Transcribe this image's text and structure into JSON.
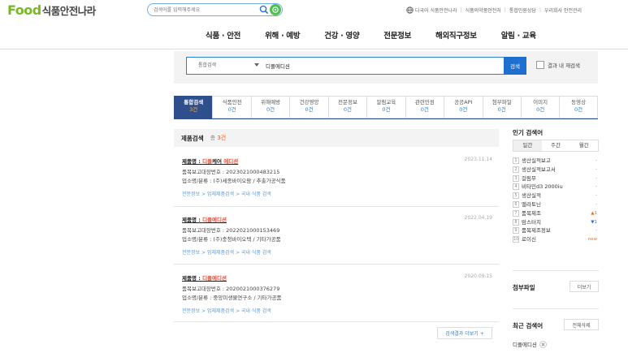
{
  "header": {
    "logo_latin": "Food",
    "logo_korean": "식품안전나라",
    "search_placeholder": "검색어를 입력해주세요",
    "utility": {
      "language": "다국어 식품안전나라",
      "links": [
        "식품의약품안전처",
        "통합민원상담",
        "우리회사 안전관리"
      ]
    }
  },
  "gnb": {
    "items": [
      "식품 · 안전",
      "위해 · 예방",
      "건강 · 영양",
      "전문정보",
      "해외직구정보",
      "알림 · 교육"
    ]
  },
  "search": {
    "scope": "통합검색",
    "query": "디플에디션",
    "button": "검색",
    "in_result_label": "결과 내 재검색"
  },
  "tabs": [
    {
      "label": "통합검색",
      "count": "3건",
      "active": true
    },
    {
      "label": "식품안전",
      "count": "0건"
    },
    {
      "label": "위해예방",
      "count": "0건"
    },
    {
      "label": "건강영양",
      "count": "0건"
    },
    {
      "label": "전문정보",
      "count": "0건"
    },
    {
      "label": "알림교육",
      "count": "0건"
    },
    {
      "label": "관련민원",
      "count": "0건"
    },
    {
      "label": "공공API",
      "count": "0건"
    },
    {
      "label": "첨부파일",
      "count": "0건"
    },
    {
      "label": "이미지",
      "count": "0건"
    },
    {
      "label": "동영상",
      "count": "0건"
    }
  ],
  "results": {
    "title": "제품검색",
    "count_prefix": "총",
    "count": "3건",
    "items": [
      {
        "name_prefix": "제품명 : ",
        "name_highlight": "디플",
        "name_mid": "케어 ",
        "name_highlight2": "에디션",
        "date": "2023.11.14",
        "report_no": "품목보고대장번호 : 2023021000483215",
        "company": "업소명/분류 : (주)세종바이오팜 / 추출가공식품",
        "path": "전문정보 > 업체제품검색 > 국내 식품 검색"
      },
      {
        "name_prefix": "제품명 : ",
        "name_highlight": "디플에디션",
        "name_mid": "",
        "name_highlight2": "",
        "date": "2022.04.19",
        "report_no": "품목보고대장번호 : 2022021000153469",
        "company": "업소명/분류 : (주)충청바이오텍 / 기타가공품",
        "path": "전문정보 > 업체제품검색 > 국내 식품 검색"
      },
      {
        "name_prefix": "제품명 : ",
        "name_highlight": "디플에디션",
        "name_mid": "",
        "name_highlight2": "",
        "date": "2020.09.15",
        "report_no": "품목보고대장번호 : 2020021000376279",
        "company": "업소명/분류 : 중앙미생물연구소 / 기타가공품",
        "path": "전문정보 > 업체제품검색 > 국내 식품 검색"
      }
    ],
    "more_button": "검색결과 더보기 +"
  },
  "sidebar": {
    "popular_title": "인기 검색어",
    "period_tabs": [
      "일간",
      "주간",
      "월간"
    ],
    "popular": [
      {
        "rank": "1",
        "term": "생산실적보고",
        "change": "-",
        "type": "none"
      },
      {
        "rank": "2",
        "term": "생산실적보고서",
        "change": "-",
        "type": "none"
      },
      {
        "rank": "3",
        "term": "걸림무",
        "change": "-",
        "type": "none"
      },
      {
        "rank": "4",
        "term": "비타민d3 2000iu",
        "change": "-",
        "type": "none"
      },
      {
        "rank": "5",
        "term": "생산실적",
        "change": "-",
        "type": "none"
      },
      {
        "rank": "6",
        "term": "멜라토닌",
        "change": "-",
        "type": "none"
      },
      {
        "rank": "7",
        "term": "품목제조",
        "change": "▲1",
        "type": "up"
      },
      {
        "rank": "8",
        "term": "맘스터치",
        "change": "▼1",
        "type": "down"
      },
      {
        "rank": "9",
        "term": "품목제조정보",
        "change": "-",
        "type": "none"
      },
      {
        "rank": "10",
        "term": "로이신",
        "change": "new",
        "type": "new"
      }
    ],
    "attachments_title": "첨부파일",
    "attachments_more": "더보기",
    "recent_title": "최근 검색어",
    "recent_delete_all": "전체삭제",
    "recent_items": [
      "디플에디션"
    ]
  }
}
